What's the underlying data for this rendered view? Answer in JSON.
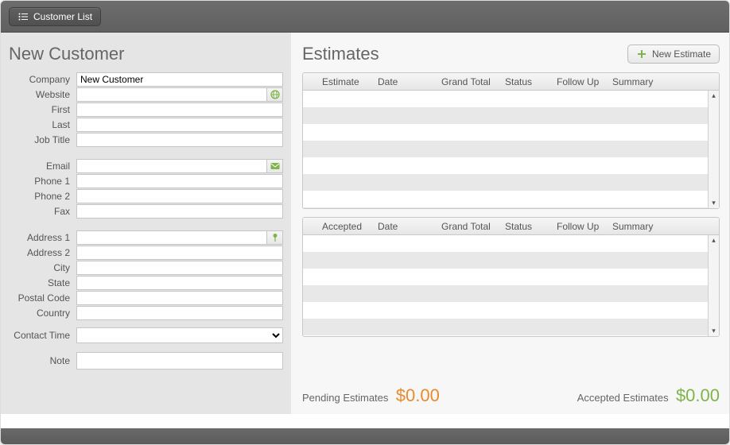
{
  "toolbar": {
    "customer_list_label": "Customer List"
  },
  "left": {
    "title": "New Customer",
    "labels": {
      "company": "Company",
      "website": "Website",
      "first": "First",
      "last": "Last",
      "job_title": "Job Title",
      "email": "Email",
      "phone1": "Phone 1",
      "phone2": "Phone 2",
      "fax": "Fax",
      "address1": "Address 1",
      "address2": "Address 2",
      "city": "City",
      "state": "State",
      "postal": "Postal Code",
      "country": "Country",
      "contact_time": "Contact Time",
      "note": "Note"
    },
    "values": {
      "company": "New Customer",
      "website": "",
      "first": "",
      "last": "",
      "job_title": "",
      "email": "",
      "phone1": "",
      "phone2": "",
      "fax": "",
      "address1": "",
      "address2": "",
      "city": "",
      "state": "",
      "postal": "",
      "country": "",
      "contact_time": "",
      "note": ""
    }
  },
  "right": {
    "title": "Estimates",
    "new_estimate_label": "New Estimate",
    "headers": {
      "estimate": "Estimate",
      "accepted": "Accepted",
      "date": "Date",
      "grand_total": "Grand Total",
      "status": "Status",
      "follow_up": "Follow Up",
      "summary": "Summary"
    },
    "pending_label": "Pending Estimates",
    "pending_value": "$0.00",
    "accepted_label": "Accepted Estimates",
    "accepted_value": "$0.00"
  },
  "icons": {
    "list": "list",
    "globe": "globe",
    "mail": "mail",
    "pin": "pin",
    "plus": "plus"
  }
}
